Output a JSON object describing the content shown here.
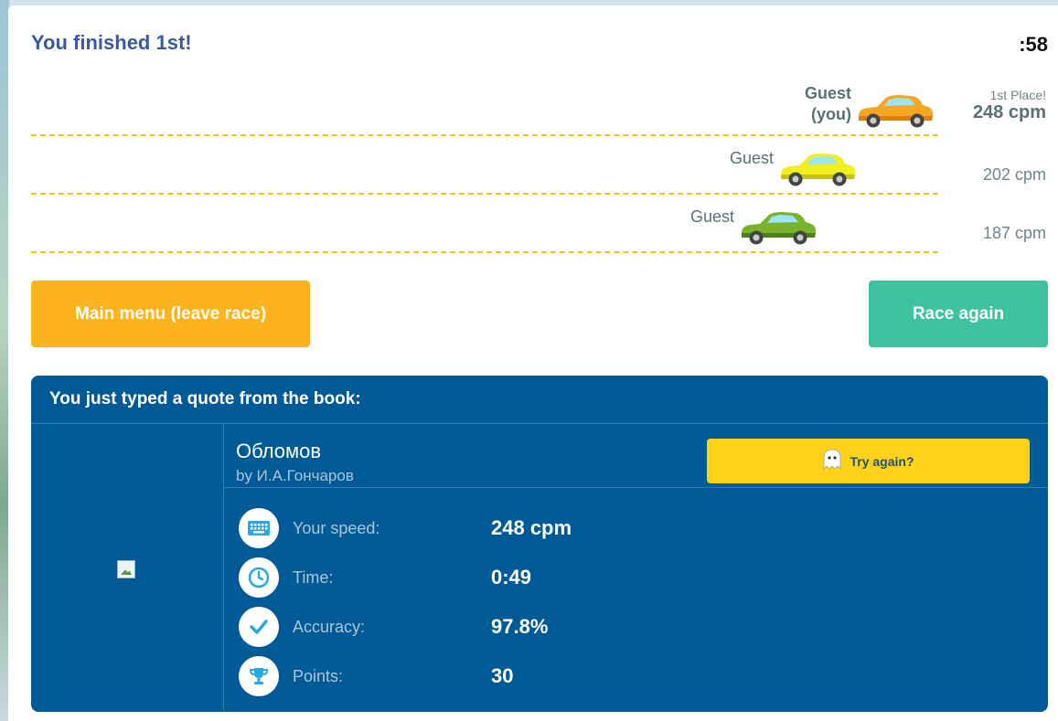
{
  "header": {
    "title": "You finished 1st!",
    "timer": ":58"
  },
  "race": {
    "racers": [
      {
        "name_line1": "Guest",
        "name_line2": "(you)",
        "place_label": "1st Place!",
        "speed": "248 cpm",
        "car_color": "#f5a623",
        "progress": 1.0
      },
      {
        "name_line1": "Guest",
        "name_line2": "",
        "place_label": "",
        "speed": "202 cpm",
        "car_color": "#f0f021",
        "progress": 0.91
      },
      {
        "name_line1": "Guest",
        "name_line2": "",
        "place_label": "",
        "speed": "187 cpm",
        "car_color": "#7ab22b",
        "progress": 0.87
      }
    ]
  },
  "buttons": {
    "main_menu": "Main menu (leave race)",
    "race_again": "Race again"
  },
  "quote": {
    "header": "You just typed a quote from the book:",
    "book_title": "Обломов",
    "book_author": "by И.А.Гончаров",
    "try_again": "Try again?",
    "try_again_icon": "ghost-icon",
    "stats": [
      {
        "label": "Your speed:",
        "value": "248 cpm",
        "icon": "keyboard-icon"
      },
      {
        "label": "Time:",
        "value": "0:49",
        "icon": "clock-icon"
      },
      {
        "label": "Accuracy:",
        "value": "97.8%",
        "icon": "checkmark-icon"
      },
      {
        "label": "Points:",
        "value": "30",
        "icon": "trophy-icon"
      }
    ]
  },
  "colors": {
    "accent_blue": "#005a96",
    "menu_button": "#fdb31d",
    "race_again_button": "#3fc2a0",
    "try_again_button": "#ffd218",
    "lane_dash": "#f0c419",
    "icon_blue": "#29a8e0"
  }
}
